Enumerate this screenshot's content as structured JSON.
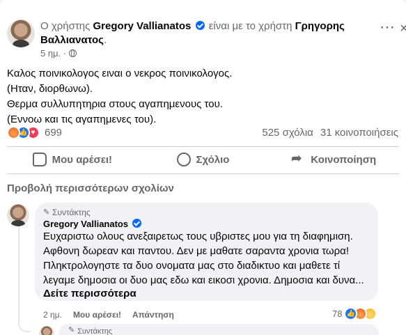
{
  "post": {
    "header_prefix": "Ο χρήστης",
    "author": "Gregory Vallianatos",
    "header_mid": "είναι με το χρήστη",
    "tagged": "Γρηγορης Βαλλιανατος",
    "header_suffix": ".",
    "time": "5 ημ. ·",
    "more_icon": "⋯",
    "close_icon": "×",
    "lines": [
      "Καλος ποινικολογος ειναι ο νεκρος ποινικολογος.",
      "(Ηταν, διορθωνω).",
      "Θερμα συλλυπητηρια στους αγαπημενους του.",
      "(Εννοω και τις αγαπημενες του)."
    ],
    "reaction_count": "699",
    "comments": "525 σχόλια",
    "shares": "31 κοινοποιήσεις"
  },
  "actions": {
    "like": "Μου αρέσει!",
    "comment": "Σχόλιο",
    "share": "Κοινοποίηση"
  },
  "comments_section": {
    "more_comments": "Προβολή περισσότερων σχολίων"
  },
  "comment": {
    "author_tag": "Συντάκτης",
    "author": "Gregory Vallianatos",
    "lines": [
      "Ευχαριστω ολους ανεξαιρετως τους υβριστες μου για τη διαφημιση.",
      "Αφθονη δωρεαν και παντου. Δεν με μαθατε σαραντα χρονια τωρα!",
      "Πληκτρολογηστε τα δυο ονοματα μας στο διαδικτυο και μαθετε τί",
      "λεγαμε δημοσια οι δυο μας εδω και εικοσι χρονια. Δημοσια και δυνα..."
    ],
    "see_more": "Δείτε περισσότερα",
    "time": "2 ημ.",
    "like": "Μου αρέσει!",
    "reply": "Απάντηση",
    "reaction_count": "78"
  },
  "reply": {
    "author_tag": "Συντάκτης"
  },
  "colors": {
    "accent": "#1877f2",
    "love": "#f33e58",
    "angry": "#e85a2a",
    "haha": "#f7b125"
  }
}
